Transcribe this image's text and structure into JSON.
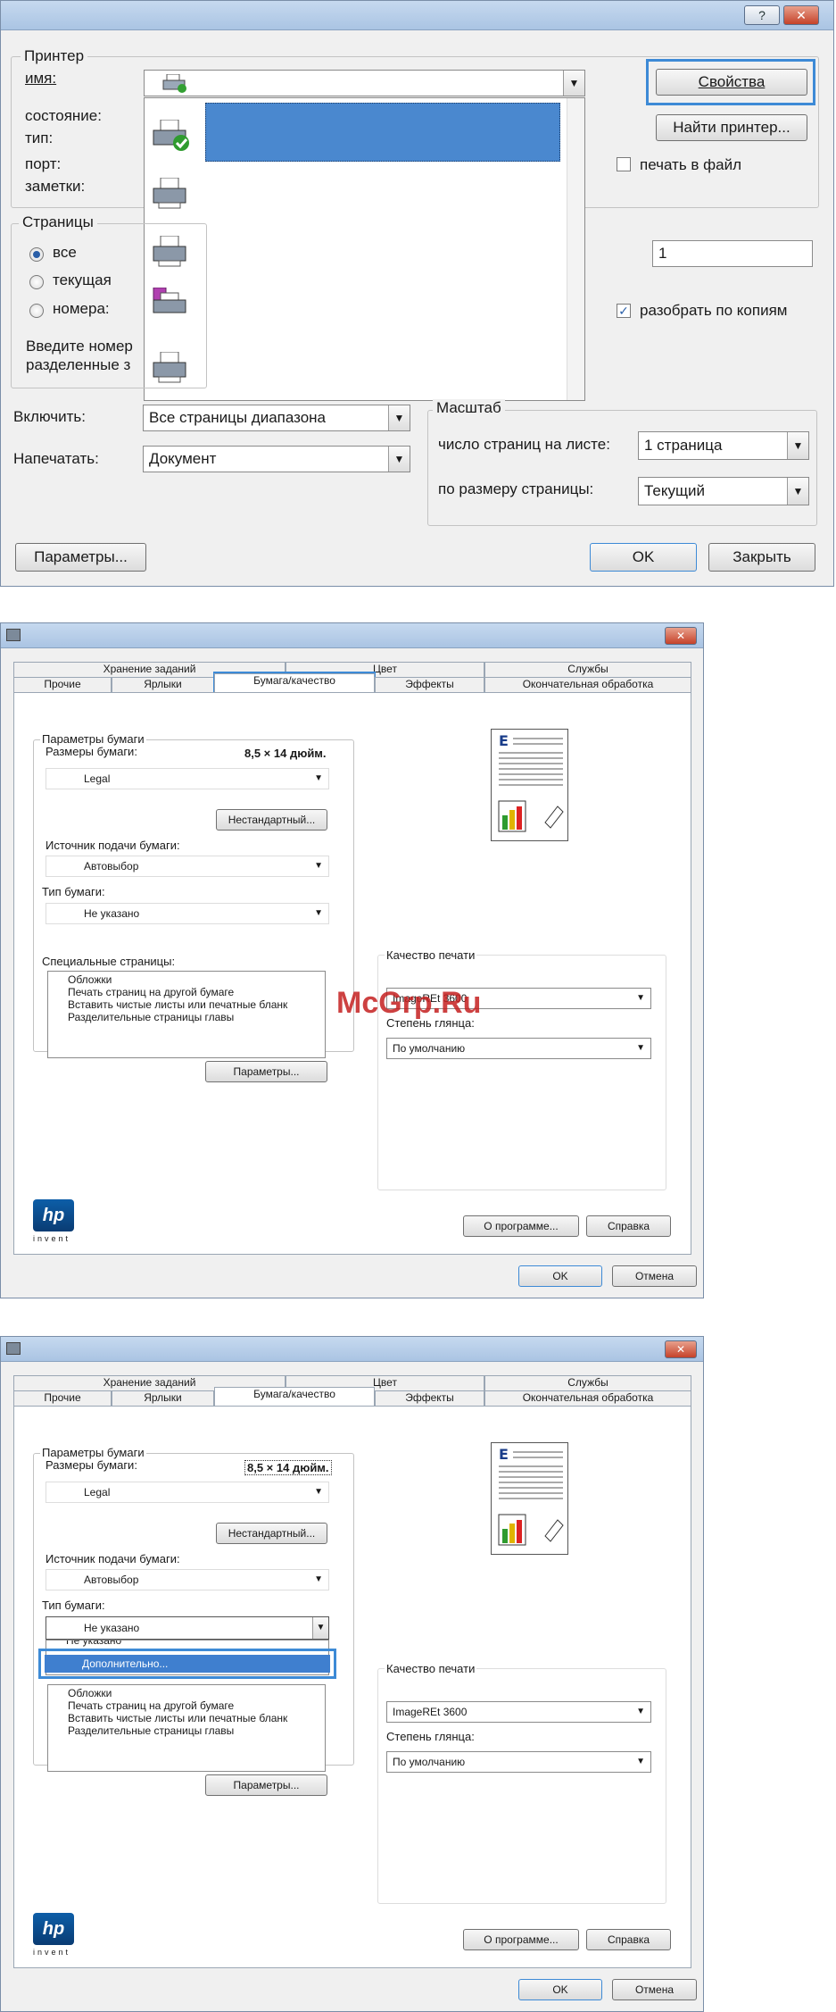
{
  "print_dialog": {
    "help_button": "?",
    "close_button": "✕",
    "printer_group": "Принтер",
    "name_label": "имя:",
    "status_label": "состояние:",
    "type_label": "тип:",
    "port_label": "порт:",
    "comments_label": "заметки:",
    "properties_button": "Свойства",
    "find_printer_button": "Найти принтер...",
    "print_to_file_label": "печать в файл",
    "pages_group": "Страницы",
    "radio_all": "все",
    "radio_current": "текущая",
    "radio_pages": "номера:",
    "pages_hint_line1": "Введите номер",
    "pages_hint_line2": "разделенные з",
    "copies_value": "1",
    "collate_label": "разобрать по копиям",
    "include_label": "Включить:",
    "include_value": "Все страницы диапазона",
    "print_label": "Напечатать:",
    "print_value": "Документ",
    "scale_group": "Масштаб",
    "pages_per_sheet_label": "число страниц на листе:",
    "pages_per_sheet_value": "1 страница",
    "fit_to_page_label": "по размеру страницы:",
    "fit_to_page_value": "Текущий",
    "options_button": "Параметры...",
    "ok_button": "OK",
    "close_dialog_button": "Закрыть"
  },
  "properties_dialog": {
    "close_button": "✕",
    "tabs_top": [
      "Хранение заданий",
      "Цвет",
      "Службы"
    ],
    "tabs_bottom": [
      "Прочие",
      "Ярлыки",
      "Бумага/качество",
      "Эффекты",
      "Окончательная обработка"
    ],
    "paper_options_group": "Параметры бумаги",
    "paper_size_label": "Размеры бумаги:",
    "paper_size_value": "8,5 × 14 дюйм.",
    "paper_size_select": "Legal",
    "custom_button": "Нестандартный...",
    "paper_source_label": "Источник подачи бумаги:",
    "paper_source_value": "Автовыбор",
    "paper_type_label": "Тип бумаги:",
    "paper_type_value": "Не указано",
    "special_pages_label": "Специальные страницы:",
    "special_pages_items": [
      "Обложки",
      "Печать страниц на другой бумаге",
      "Вставить чистые листы или печатные бланк",
      "Разделительные страницы главы"
    ],
    "settings_button": "Параметры...",
    "print_quality_group": "Качество печати",
    "print_quality_value": "ImageREt 3600",
    "gloss_label": "Степень глянца:",
    "gloss_value": "По умолчанию",
    "about_button": "О программе...",
    "help_button": "Справка",
    "ok_button": "OK",
    "cancel_button": "Отмена",
    "dropdown_partial": "Не указано",
    "dropdown_more": "Дополнительно..."
  },
  "watermark": "McGrp.Ru",
  "hp_logo": "hp",
  "hp_tagline": "invent"
}
